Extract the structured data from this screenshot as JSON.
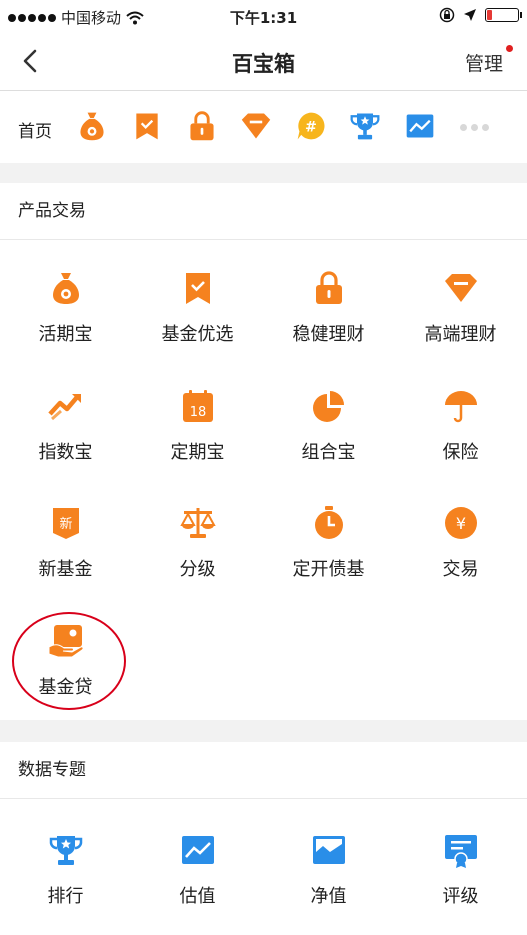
{
  "status_bar": {
    "carrier": "中国移动",
    "time": "下午1:31"
  },
  "nav": {
    "title": "百宝箱",
    "manage_label": "管理"
  },
  "home": {
    "label": "首页",
    "icons": [
      "money-bag-icon",
      "bookmark-icon",
      "lock-icon",
      "diamond-icon",
      "hash-bubble-icon",
      "trophy-icon",
      "trend-chart-icon"
    ]
  },
  "products": {
    "title": "产品交易",
    "items": [
      {
        "label": "活期宝",
        "icon": "money-bag-icon"
      },
      {
        "label": "基金优选",
        "icon": "bookmark-check-icon"
      },
      {
        "label": "稳健理财",
        "icon": "lock-icon"
      },
      {
        "label": "高端理财",
        "icon": "diamond-icon"
      },
      {
        "label": "指数宝",
        "icon": "trend-arrow-icon"
      },
      {
        "label": "定期宝",
        "icon": "calendar-icon",
        "badge": "18"
      },
      {
        "label": "组合宝",
        "icon": "pie-chart-icon"
      },
      {
        "label": "保险",
        "icon": "umbrella-icon"
      },
      {
        "label": "新基金",
        "icon": "new-badge-icon",
        "badge": "新"
      },
      {
        "label": "分级",
        "icon": "scale-icon"
      },
      {
        "label": "定开债基",
        "icon": "stopwatch-icon"
      },
      {
        "label": "交易",
        "icon": "yen-coin-icon",
        "badge": "¥"
      },
      {
        "label": "基金贷",
        "icon": "hand-card-icon"
      }
    ]
  },
  "data_topics": {
    "title": "数据专题",
    "items": [
      {
        "label": "排行",
        "icon": "trophy-icon"
      },
      {
        "label": "估值",
        "icon": "trend-chart-icon"
      },
      {
        "label": "净值",
        "icon": "picture-chart-icon"
      },
      {
        "label": "评级",
        "icon": "certificate-icon"
      }
    ]
  },
  "colors": {
    "orange": "#f5821f",
    "blue": "#2a8ee8",
    "highlight_red": "#d8001a"
  }
}
